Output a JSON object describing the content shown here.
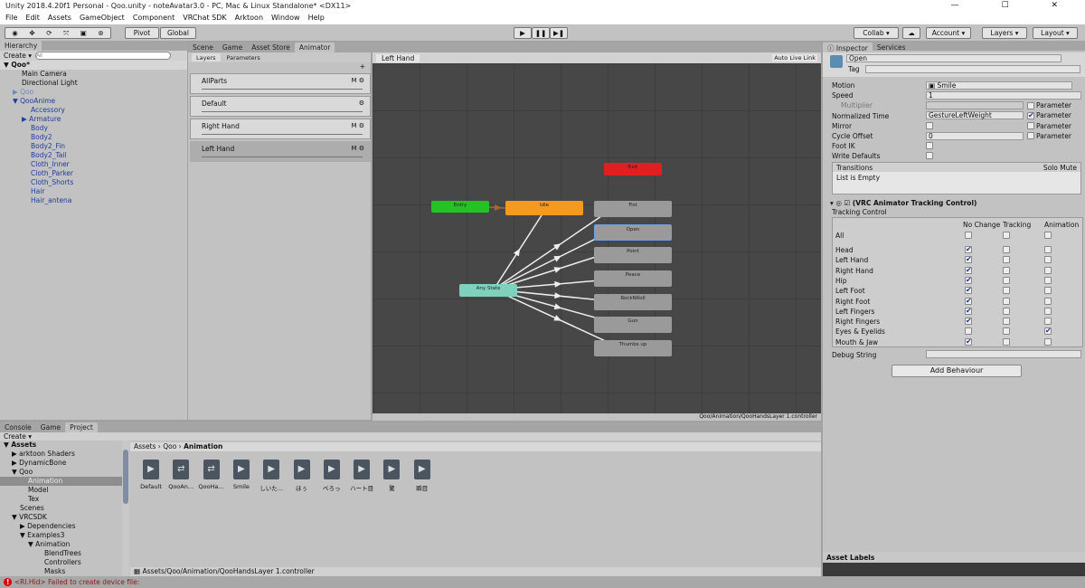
{
  "window": {
    "title": "Unity 2018.4.20f1 Personal - Qoo.unity - noteAvatar3.0 - PC, Mac & Linux Standalone* <DX11>",
    "controls": "— ☐ ✕"
  },
  "menu": [
    "File",
    "Edit",
    "Assets",
    "GameObject",
    "Component",
    "VRChat SDK",
    "Arktoon",
    "Window",
    "Help"
  ],
  "toolbar": {
    "tools": [
      "◉",
      "✥",
      "⟳",
      "⤧",
      "▣",
      "⊛"
    ],
    "pivot": "Pivot",
    "global": "Global",
    "play": "▶",
    "pause": "❚❚",
    "step": "▶❚",
    "collab": "Collab ▾",
    "cloud": "☁",
    "account": "Account ▾",
    "layers": "Layers ▾",
    "layout": "Layout ▾"
  },
  "hierarchy": {
    "tab": "Hierarchy",
    "create": "Create ▾",
    "search_placeholder": "All",
    "scene": "Qoo*",
    "items": [
      {
        "label": "Main Camera",
        "indent": 1,
        "cls": ""
      },
      {
        "label": "Directional Light",
        "indent": 1,
        "cls": ""
      },
      {
        "label": "▶ Qoo",
        "indent": 0,
        "cls": "lblue"
      },
      {
        "label": "▼ QooAnime",
        "indent": 0,
        "cls": "blue"
      },
      {
        "label": "Accessory",
        "indent": 2,
        "cls": "blue"
      },
      {
        "label": "▶ Armature",
        "indent": 1,
        "cls": "blue"
      },
      {
        "label": "Body",
        "indent": 2,
        "cls": "blue"
      },
      {
        "label": "Body2",
        "indent": 2,
        "cls": "blue"
      },
      {
        "label": "Body2_Fin",
        "indent": 2,
        "cls": "blue"
      },
      {
        "label": "Body2_Tail",
        "indent": 2,
        "cls": "blue"
      },
      {
        "label": "Cloth_Inner",
        "indent": 2,
        "cls": "blue"
      },
      {
        "label": "Cloth_Parker",
        "indent": 2,
        "cls": "blue"
      },
      {
        "label": "Cloth_Shorts",
        "indent": 2,
        "cls": "blue"
      },
      {
        "label": "Hair",
        "indent": 2,
        "cls": "blue"
      },
      {
        "label": "Hair_antena",
        "indent": 2,
        "cls": "blue"
      }
    ]
  },
  "center_tabs": [
    "Scene",
    "Game",
    "Asset Store",
    "Animator"
  ],
  "animator": {
    "subtabs": [
      "Layers",
      "Parameters"
    ],
    "breadcrumb": "Left Hand",
    "auto_live_link": "Auto Live Link",
    "path": "Qoo/Animation/QooHandsLayer 1.controller",
    "layers": [
      {
        "name": "AllParts",
        "icons": "M ⚙"
      },
      {
        "name": "Default",
        "icons": "⚙"
      },
      {
        "name": "Right Hand",
        "icons": "M ⚙"
      },
      {
        "name": "Left Hand",
        "icons": "M ⚙"
      }
    ],
    "nodes": [
      {
        "name": "Exit",
        "color": "#e02020"
      },
      {
        "name": "Entry",
        "color": "#22c322"
      },
      {
        "name": "Idle",
        "color": "#f59a20"
      },
      {
        "name": "Any State",
        "color": "#7fd0bd"
      },
      {
        "name": "Fist",
        "color": "#9a9a9a"
      },
      {
        "name": "Open",
        "color": "#9a9a9a"
      },
      {
        "name": "Point",
        "color": "#9a9a9a"
      },
      {
        "name": "Peace",
        "color": "#9a9a9a"
      },
      {
        "name": "RockNRoll",
        "color": "#9a9a9a"
      },
      {
        "name": "Gun",
        "color": "#9a9a9a"
      },
      {
        "name": "Thumbs up",
        "color": "#9a9a9a"
      }
    ]
  },
  "inspector": {
    "tabs": [
      "Inspector",
      "Services"
    ],
    "name": "Open",
    "tag_label": "Tag",
    "motion_label": "Motion",
    "motion": "Smile",
    "speed_label": "Speed",
    "speed": "1",
    "multiplier_label": "Multiplier",
    "normalized_label": "Normalized Time",
    "normalized": "GestureLeftWeight",
    "mirror_label": "Mirror",
    "cycle_label": "Cycle Offset",
    "cycle": "0",
    "footik_label": "Foot IK",
    "write_label": "Write Defaults",
    "parameter": "Parameter",
    "transitions": "Transitions",
    "solo_mute": "Solo Mute",
    "list_empty": "List is Empty",
    "component": "(VRC Animator Tracking Control)",
    "tracking_control": "Tracking Control",
    "cols": [
      "No Change",
      "Tracking",
      "Animation"
    ],
    "rows": [
      {
        "label": "All",
        "v": [
          0,
          0,
          0
        ]
      },
      {
        "label": "Head",
        "v": [
          1,
          0,
          0
        ]
      },
      {
        "label": "Left Hand",
        "v": [
          1,
          0,
          0
        ]
      },
      {
        "label": "Right Hand",
        "v": [
          1,
          0,
          0
        ]
      },
      {
        "label": "Hip",
        "v": [
          1,
          0,
          0
        ]
      },
      {
        "label": "Left Foot",
        "v": [
          1,
          0,
          0
        ]
      },
      {
        "label": "Right Foot",
        "v": [
          1,
          0,
          0
        ]
      },
      {
        "label": "Left Fingers",
        "v": [
          1,
          0,
          0
        ]
      },
      {
        "label": "Right Fingers",
        "v": [
          1,
          0,
          0
        ]
      },
      {
        "label": "Eyes & Eyelids",
        "v": [
          0,
          0,
          1
        ]
      },
      {
        "label": "Mouth & Jaw",
        "v": [
          1,
          0,
          0
        ]
      }
    ],
    "debug_label": "Debug String",
    "add_behaviour": "Add Behaviour",
    "asset_labels": "Asset Labels"
  },
  "project": {
    "tabs": [
      "Console",
      "Game",
      "Project"
    ],
    "create": "Create ▾",
    "tree": [
      {
        "label": "▼ Assets",
        "indent": 0
      },
      {
        "label": "▶ arktoon Shaders",
        "indent": 1
      },
      {
        "label": "▶ DynamicBone",
        "indent": 1
      },
      {
        "label": "▼ Qoo",
        "indent": 1
      },
      {
        "label": "Animation",
        "indent": 3,
        "sel": true
      },
      {
        "label": "Model",
        "indent": 3
      },
      {
        "label": "Tex",
        "indent": 3
      },
      {
        "label": "Scenes",
        "indent": 2
      },
      {
        "label": "▼ VRCSDK",
        "indent": 1
      },
      {
        "label": "▶ Dependencies",
        "indent": 2
      },
      {
        "label": "▼ Examples3",
        "indent": 2
      },
      {
        "label": "▼ Animation",
        "indent": 3
      },
      {
        "label": "BlendTrees",
        "indent": 5
      },
      {
        "label": "Controllers",
        "indent": 5
      },
      {
        "label": "Masks",
        "indent": 5
      }
    ],
    "breadcrumb": [
      "Assets",
      "Qoo",
      "Animation"
    ],
    "assets": [
      {
        "name": "Default",
        "icon": "▶"
      },
      {
        "name": "QooAn…",
        "icon": "⇄"
      },
      {
        "name": "QooHa…",
        "icon": "⇄"
      },
      {
        "name": "Smile",
        "icon": "▶"
      },
      {
        "name": "しいた…",
        "icon": "▶"
      },
      {
        "name": "ほぅ",
        "icon": "▶"
      },
      {
        "name": "べろっ",
        "icon": "▶"
      },
      {
        "name": "ハート目",
        "icon": "▶"
      },
      {
        "name": "驚",
        "icon": "▶"
      },
      {
        "name": "瞬目",
        "icon": "▶"
      }
    ],
    "selected_path": "Assets/Qoo/Animation/QooHandsLayer 1.controller"
  },
  "status": {
    "message": "<RI.Hid> Failed to create device file:"
  }
}
